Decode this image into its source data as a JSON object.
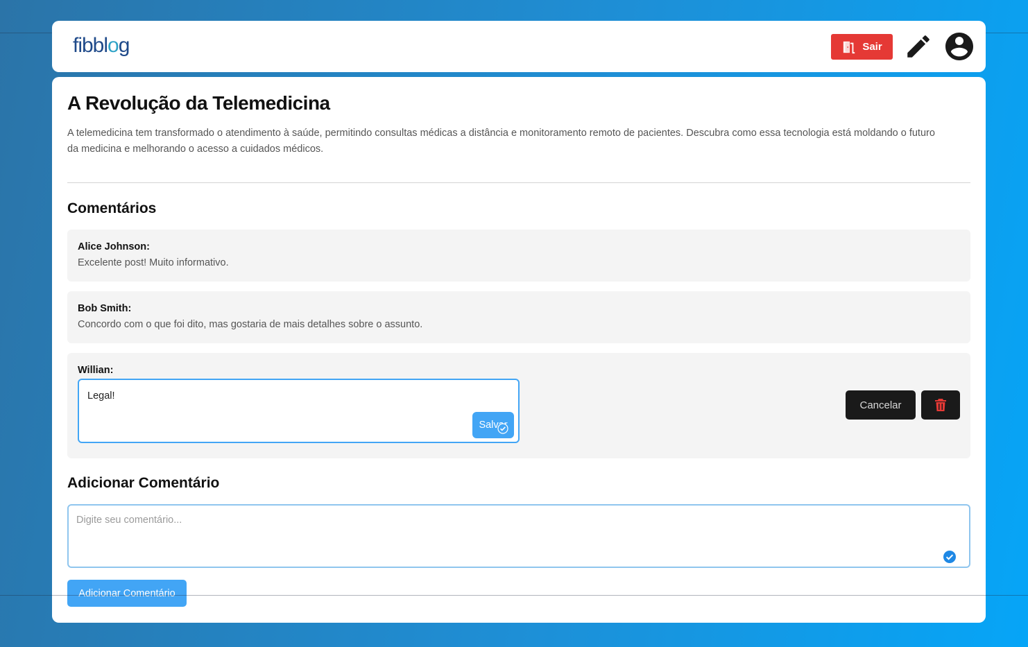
{
  "header": {
    "logo": {
      "part1": "fibbl",
      "part2": "o",
      "part3": "g"
    },
    "exit_label": "Sair",
    "colors": {
      "exit": "#e53935",
      "logo_dark": "#1f4a8a",
      "logo_accent": "#2fa3c7"
    }
  },
  "post": {
    "title": "A Revolução da Telemedicina",
    "description": "A telemedicina tem transformado o atendimento à saúde, permitindo consultas médicas a distância e monitoramento remoto de pacientes. Descubra como essa tecnologia está moldando o futuro da medicina e melhorando o acesso a cuidados médicos."
  },
  "comments": {
    "heading": "Comentários",
    "items": [
      {
        "author": "Alice Johnson:",
        "text": "Excelente post! Muito informativo."
      },
      {
        "author": "Bob Smith:",
        "text": "Concordo com o que foi dito, mas gostaria de mais detalhes sobre o assunto."
      }
    ],
    "editing": {
      "author": "Willian:",
      "value": "Legal!",
      "save_label": "Salvar",
      "cancel_label": "Cancelar"
    }
  },
  "add_comment": {
    "heading": "Adicionar Comentário",
    "placeholder": "Digite seu comentário...",
    "button_label": "Adicionar Comentário"
  },
  "icons": {
    "exit": "door-exit-icon",
    "edit": "pencil-icon",
    "profile": "account-circle-icon",
    "delete": "trash-icon",
    "check": "check-circle-icon"
  },
  "colors": {
    "primary": "#42a5f5",
    "dark_button": "#1a1a1a",
    "delete_icon": "#e53935",
    "comment_bg": "#f4f4f4"
  }
}
